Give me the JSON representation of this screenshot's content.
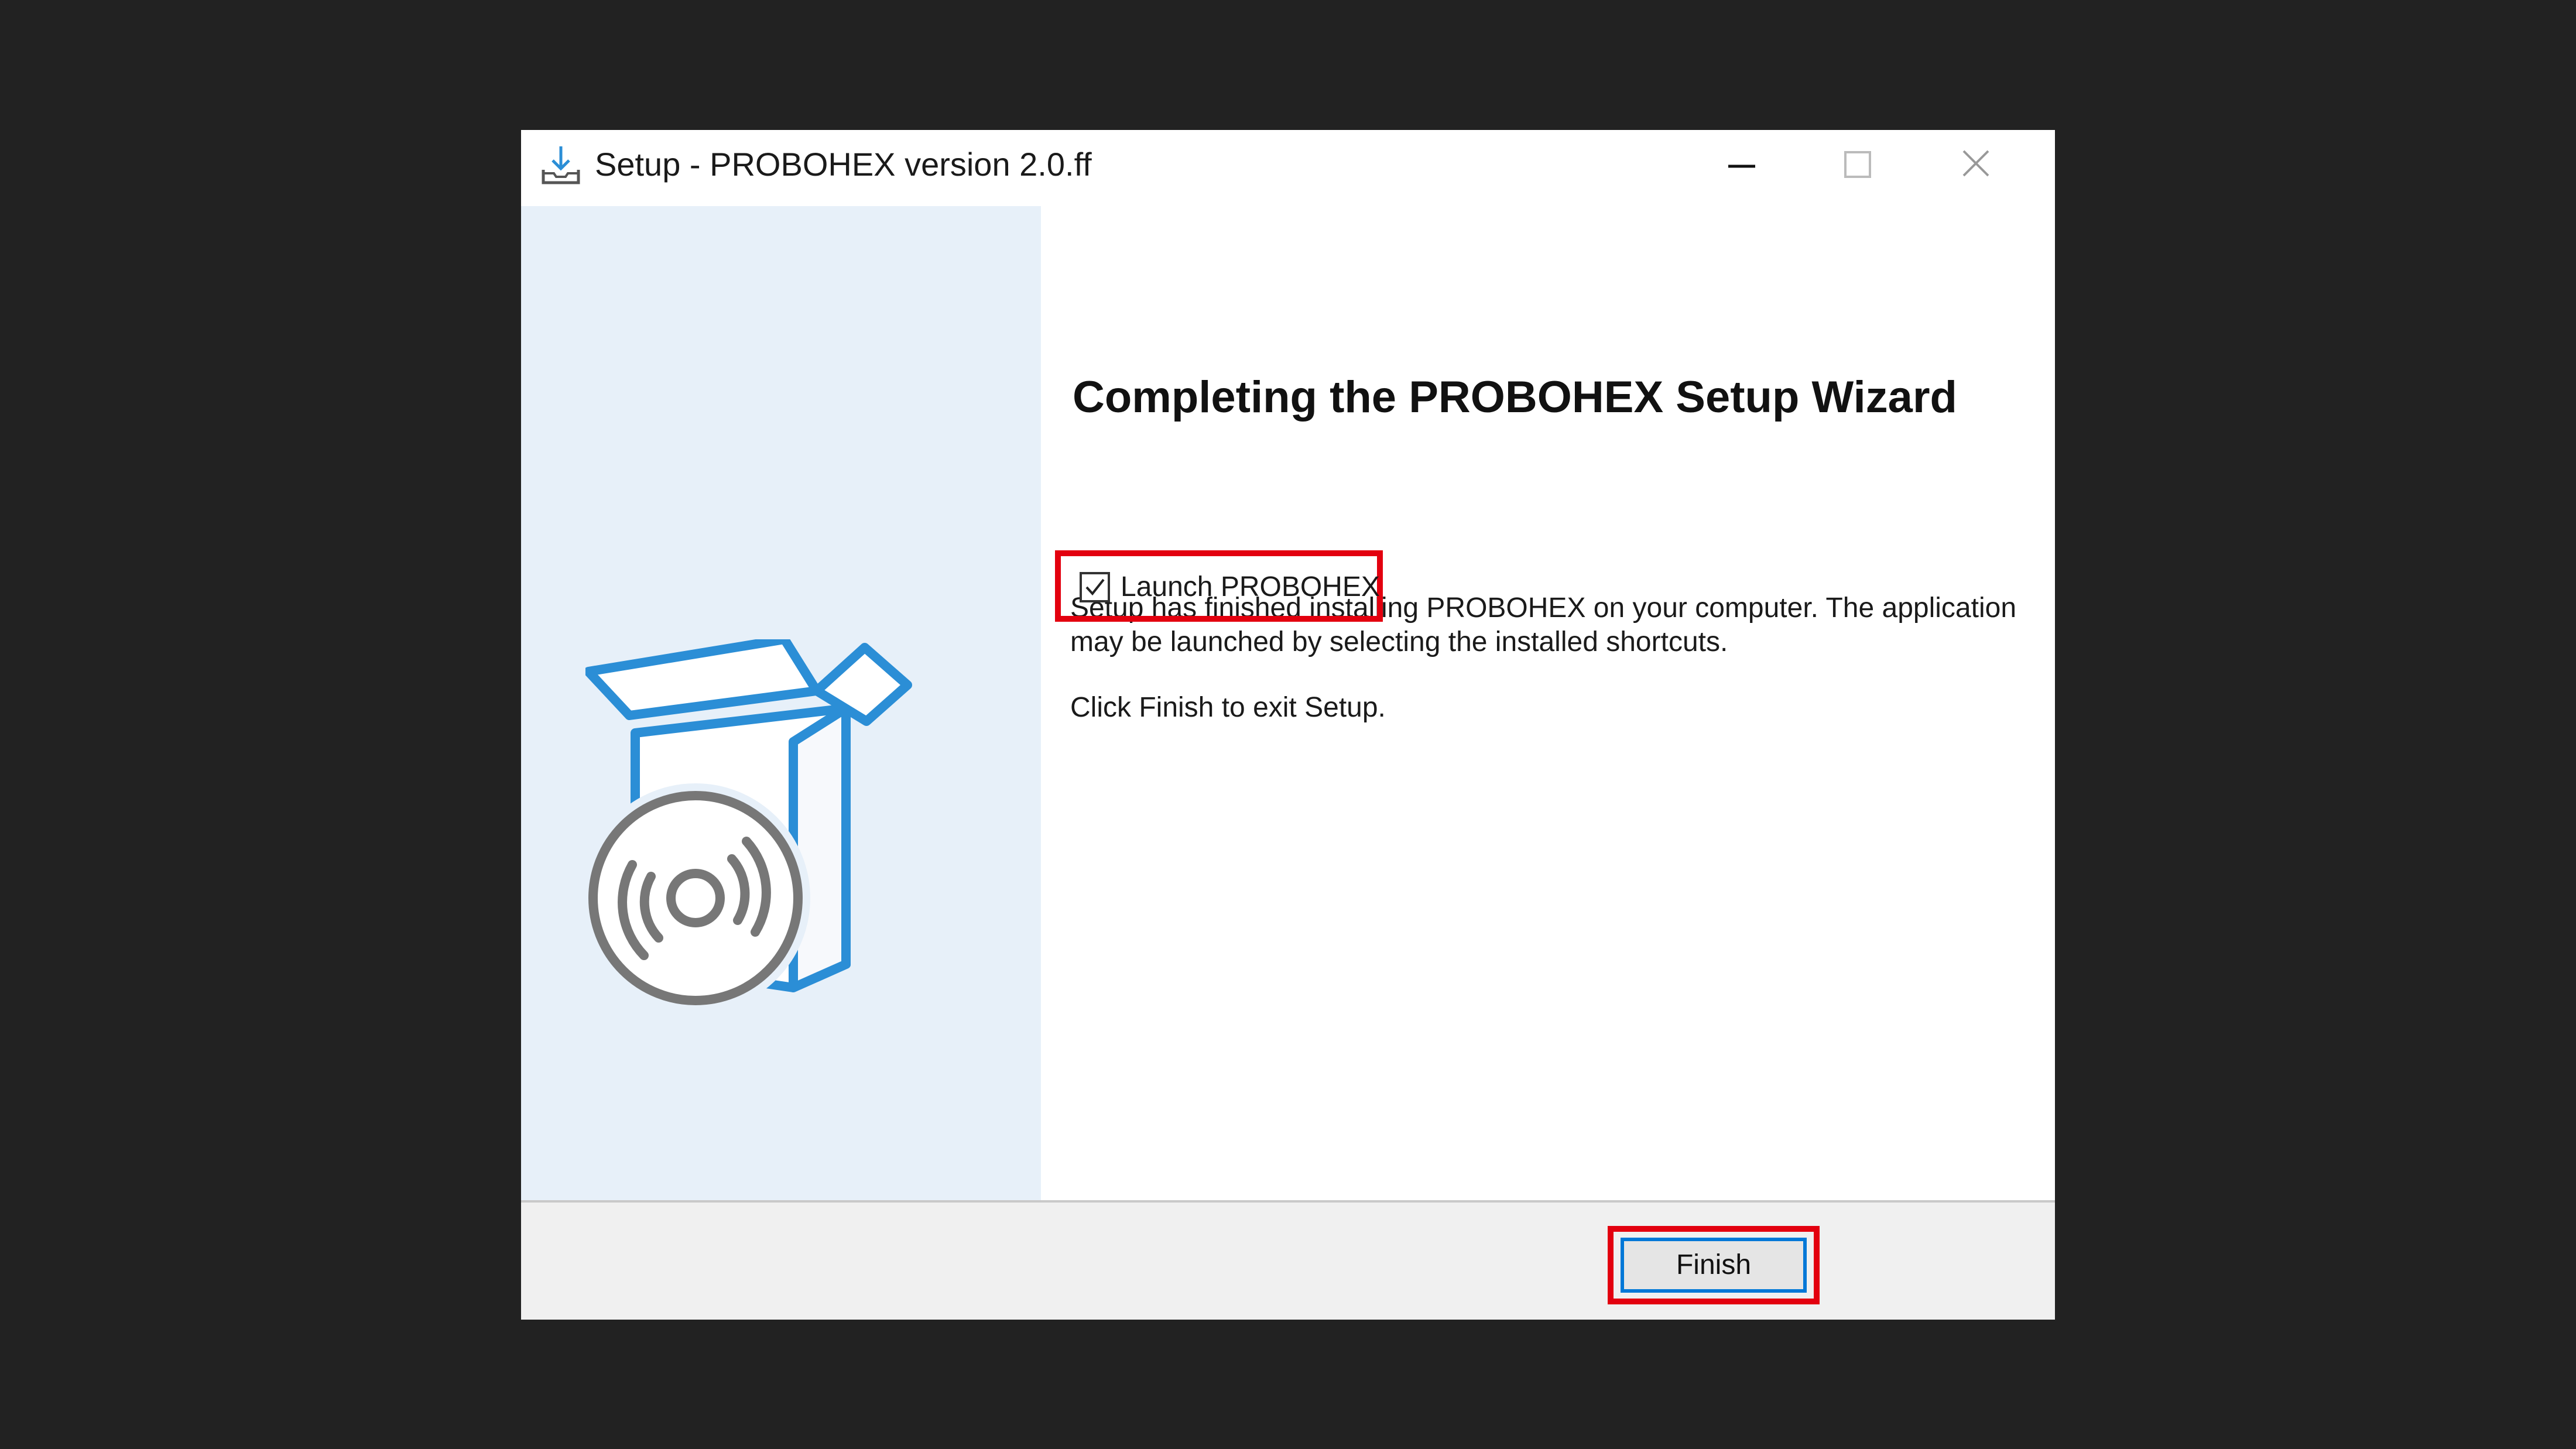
{
  "window": {
    "title": "Setup - PROBOHEX version 2.0.ff",
    "icon": "download-tray-icon",
    "controls": [
      "minimize-icon",
      "maximize-icon",
      "close-icon"
    ]
  },
  "side_panel": {
    "illustration": "box-with-disc-icon"
  },
  "content": {
    "heading": "Completing the PROBOHEX Setup Wizard",
    "paragraph_line1": "Setup has finished installing PROBOHEX on your computer. The application",
    "paragraph_line2": "may be launched by selecting the installed shortcuts.",
    "paragraph2": "Click Finish to exit Setup.",
    "launch_checkbox": {
      "label": "Launch PROBOHEX",
      "checked": true
    }
  },
  "footer": {
    "finish_label": "Finish"
  },
  "colors": {
    "accent": "#0078d7",
    "highlight": "#e3000f",
    "side_panel_bg": "#e7f0f9",
    "box_blue": "#2b8ed6",
    "disc_gray": "#777777"
  }
}
